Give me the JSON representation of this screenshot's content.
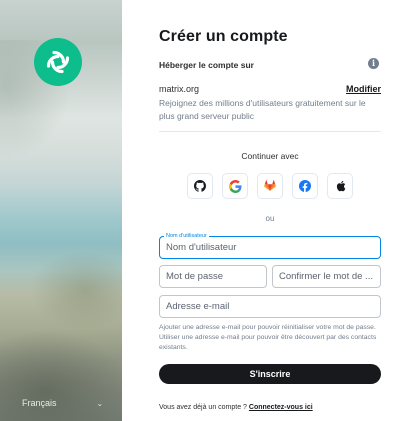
{
  "language": {
    "label": "Français"
  },
  "page": {
    "title": "Créer un compte",
    "host_label": "Héberger le compte sur",
    "server_name": "matrix.org",
    "modify_label": "Modifier",
    "server_desc": "Rejoignez des millions d'utilisateurs gratuitement sur le plus grand serveur public",
    "continue_label": "Continuer avec",
    "or_label": "ou"
  },
  "sso": [
    {
      "icon": "github-icon"
    },
    {
      "icon": "google-icon"
    },
    {
      "icon": "gitlab-icon"
    },
    {
      "icon": "facebook-icon"
    },
    {
      "icon": "apple-icon"
    }
  ],
  "form": {
    "username_label": "Nom d'utilisateur",
    "username_placeholder": "Nom d'utilisateur",
    "password_placeholder": "Mot de passe",
    "confirm_placeholder": "Confirmer le mot de ...",
    "email_placeholder": "Adresse e-mail",
    "help_text": "Ajouter une adresse e-mail pour pouvoir réinitialiser votre mot de passe. Utiliser une adresse e-mail pour pouvoir être découvert par des contacts existants.",
    "submit_label": "S'inscrire"
  },
  "footer": {
    "have_account": "Vous avez déjà un compte ?",
    "login_link": "Connectez-vous ici"
  },
  "colors": {
    "accent": "#0dbd8b",
    "focus": "#0086e6",
    "primary_button": "#17191c"
  }
}
